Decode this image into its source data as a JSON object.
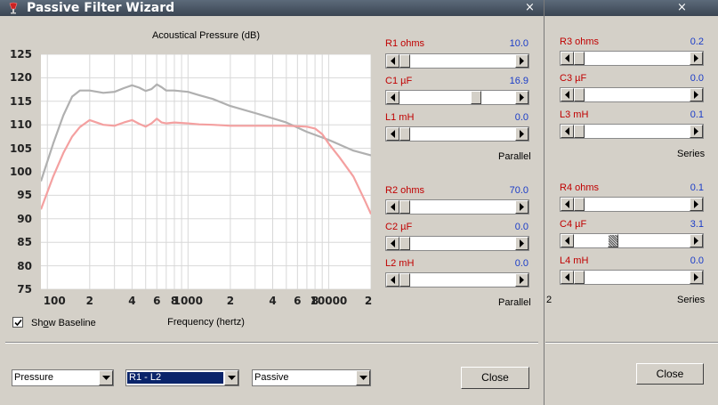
{
  "window_title": "Passive Filter Wizard",
  "close_glyph": "×",
  "chart_data": {
    "type": "line",
    "title": "Acoustical Pressure (dB)",
    "xlabel": "Frequency (hertz)",
    "ylabel": "",
    "xscale": "log",
    "xlim": [
      90,
      20000
    ],
    "ylim": [
      75,
      125
    ],
    "grid": true,
    "yticks": [
      "125",
      "120",
      "115",
      "110",
      "105",
      "100",
      "95",
      "90",
      "85",
      "80",
      "75"
    ],
    "xticks": [
      "100",
      "2",
      "4",
      "6",
      "8",
      "1000",
      "2",
      "4",
      "6",
      "8",
      "10000",
      "2"
    ],
    "series": [
      {
        "color": "#b0b0b0",
        "points": [
          [
            90,
            98
          ],
          [
            110,
            106
          ],
          [
            130,
            112
          ],
          [
            150,
            116
          ],
          [
            170,
            117.3
          ],
          [
            200,
            117.3
          ],
          [
            250,
            116.8
          ],
          [
            300,
            117
          ],
          [
            350,
            117.8
          ],
          [
            400,
            118.4
          ],
          [
            450,
            117.9
          ],
          [
            500,
            117.2
          ],
          [
            550,
            117.6
          ],
          [
            600,
            118.6
          ],
          [
            650,
            118
          ],
          [
            700,
            117.3
          ],
          [
            800,
            117.3
          ],
          [
            1000,
            117
          ],
          [
            1200,
            116.3
          ],
          [
            1500,
            115.5
          ],
          [
            2000,
            114
          ],
          [
            3000,
            112.5
          ],
          [
            5000,
            110.5
          ],
          [
            7000,
            108.5
          ],
          [
            10000,
            106.8
          ],
          [
            15000,
            104.5
          ],
          [
            20000,
            103.5
          ]
        ]
      },
      {
        "color": "#f4a0a0",
        "points": [
          [
            90,
            92
          ],
          [
            110,
            99
          ],
          [
            130,
            104
          ],
          [
            150,
            107.5
          ],
          [
            170,
            109.5
          ],
          [
            200,
            111
          ],
          [
            250,
            110
          ],
          [
            300,
            109.8
          ],
          [
            350,
            110.5
          ],
          [
            400,
            111
          ],
          [
            450,
            110.2
          ],
          [
            500,
            109.6
          ],
          [
            550,
            110.3
          ],
          [
            600,
            111.3
          ],
          [
            650,
            110.5
          ],
          [
            700,
            110.3
          ],
          [
            800,
            110.5
          ],
          [
            1000,
            110.3
          ],
          [
            1200,
            110.1
          ],
          [
            1500,
            110
          ],
          [
            2000,
            109.8
          ],
          [
            3000,
            109.8
          ],
          [
            5000,
            109.8
          ],
          [
            6000,
            109.7
          ],
          [
            7000,
            109.6
          ],
          [
            8000,
            109.2
          ],
          [
            9000,
            108
          ],
          [
            10000,
            106
          ],
          [
            12000,
            103
          ],
          [
            15000,
            99
          ],
          [
            18000,
            94
          ],
          [
            20000,
            91
          ]
        ]
      }
    ]
  },
  "show_baseline": {
    "label_before": "Sh",
    "label_accel": "o",
    "label_after": "w Baseline",
    "checked": true
  },
  "front": {
    "group1": {
      "rows": [
        {
          "label": "R1  ohms",
          "value": "10.0",
          "thumb": 0.0
        },
        {
          "label": "C1  µF",
          "value": "16.9",
          "thumb": 0.75
        },
        {
          "label": "L1  mH",
          "value": "0.0",
          "thumb": 0.0
        }
      ],
      "mode": "Parallel"
    },
    "group2": {
      "rows": [
        {
          "label": "R2  ohms",
          "value": "70.0",
          "thumb": 0.0
        },
        {
          "label": "C2  µF",
          "value": "0.0",
          "thumb": 0.0
        },
        {
          "label": "L2  mH",
          "value": "0.0",
          "thumb": 0.0
        }
      ],
      "mode": "Parallel"
    },
    "combo1": "Pressure",
    "combo2": "R1 - L2",
    "combo3": "Passive",
    "close": "Close"
  },
  "back": {
    "group1": {
      "rows": [
        {
          "label": "R3  ohms",
          "value": "0.2",
          "thumb": 0.0
        },
        {
          "label": "C3  µF",
          "value": "0.0",
          "thumb": 0.0
        },
        {
          "label": "L3  mH",
          "value": "0.1",
          "thumb": 0.0
        }
      ],
      "mode": "Series"
    },
    "group2": {
      "rows": [
        {
          "label": "R4  ohms",
          "value": "0.1",
          "thumb": 0.0
        },
        {
          "label": "C4  µF",
          "value": "3.1",
          "thumb": 0.3
        },
        {
          "label": "L4  mH",
          "value": "0.0",
          "thumb": 0.0
        }
      ],
      "mode": "Series"
    },
    "close": "Close",
    "partial_glyph": "2"
  }
}
